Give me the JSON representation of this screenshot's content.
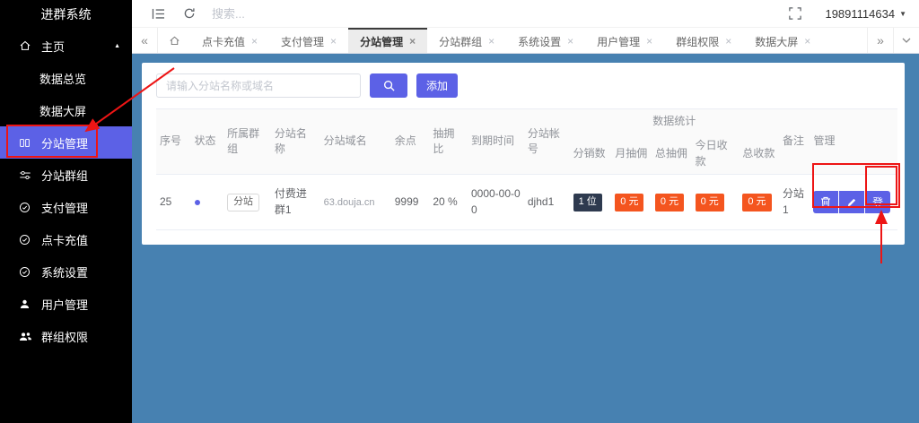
{
  "app": {
    "title": "进群系统",
    "username": "19891114634"
  },
  "topbar": {
    "search_placeholder": "搜索..."
  },
  "icons": {
    "close": "×",
    "caret_up": "▲",
    "caret_down": "▼",
    "tabs_prev": "«",
    "tabs_next": "»"
  },
  "sidebar": {
    "items": [
      {
        "label": "主页"
      },
      {
        "label": "数据总览"
      },
      {
        "label": "数据大屏"
      },
      {
        "label": "分站管理",
        "active": true
      },
      {
        "label": "分站群组"
      },
      {
        "label": "支付管理"
      },
      {
        "label": "点卡充值"
      },
      {
        "label": "系统设置"
      },
      {
        "label": "用户管理"
      },
      {
        "label": "群组权限"
      }
    ]
  },
  "tabs": [
    {
      "label": "点卡充值"
    },
    {
      "label": "支付管理"
    },
    {
      "label": "分站管理",
      "active": true
    },
    {
      "label": "分站群组"
    },
    {
      "label": "系统设置"
    },
    {
      "label": "用户管理"
    },
    {
      "label": "群组权限"
    },
    {
      "label": "数据大屏"
    }
  ],
  "toolbar": {
    "search_placeholder": "请输入分站名称或域名",
    "add_label": "添加"
  },
  "table": {
    "headers": {
      "index": "序号",
      "status": "状态",
      "group": "所属群组",
      "site_name": "分站名称",
      "domain": "分站域名",
      "points": "余点",
      "commission_rate": "抽拥比",
      "expire": "到期时间",
      "account": "分站帐号",
      "stats_group": "数据统计",
      "distributors": "分销数",
      "month_commission": "月抽佣",
      "total_commission": "总抽佣",
      "today_income": "今日收款",
      "total_income": "总收款",
      "remark": "备注",
      "manage": "管理"
    },
    "row": {
      "index": "25",
      "group_badge": "分站",
      "site_name": "付费进群1",
      "domain": "63.douja.cn",
      "points": "9999",
      "commission_rate": "20 %",
      "expire": "0000-00-00",
      "account": "djhd1",
      "distributors": "1 位",
      "month_commission": "0 元",
      "total_commission": "0 元",
      "today_income": "0 元",
      "total_income": "0 元",
      "remark": "分站1"
    },
    "manage": {
      "login_label": "登"
    }
  },
  "colors": {
    "accent_purple": "#5c61e6",
    "content_bg": "#4781b1",
    "badge_navy": "#2e3a4f",
    "badge_orange": "#f4551f",
    "status_dot": "#5c61e6",
    "annotation_red": "#ed1515"
  }
}
